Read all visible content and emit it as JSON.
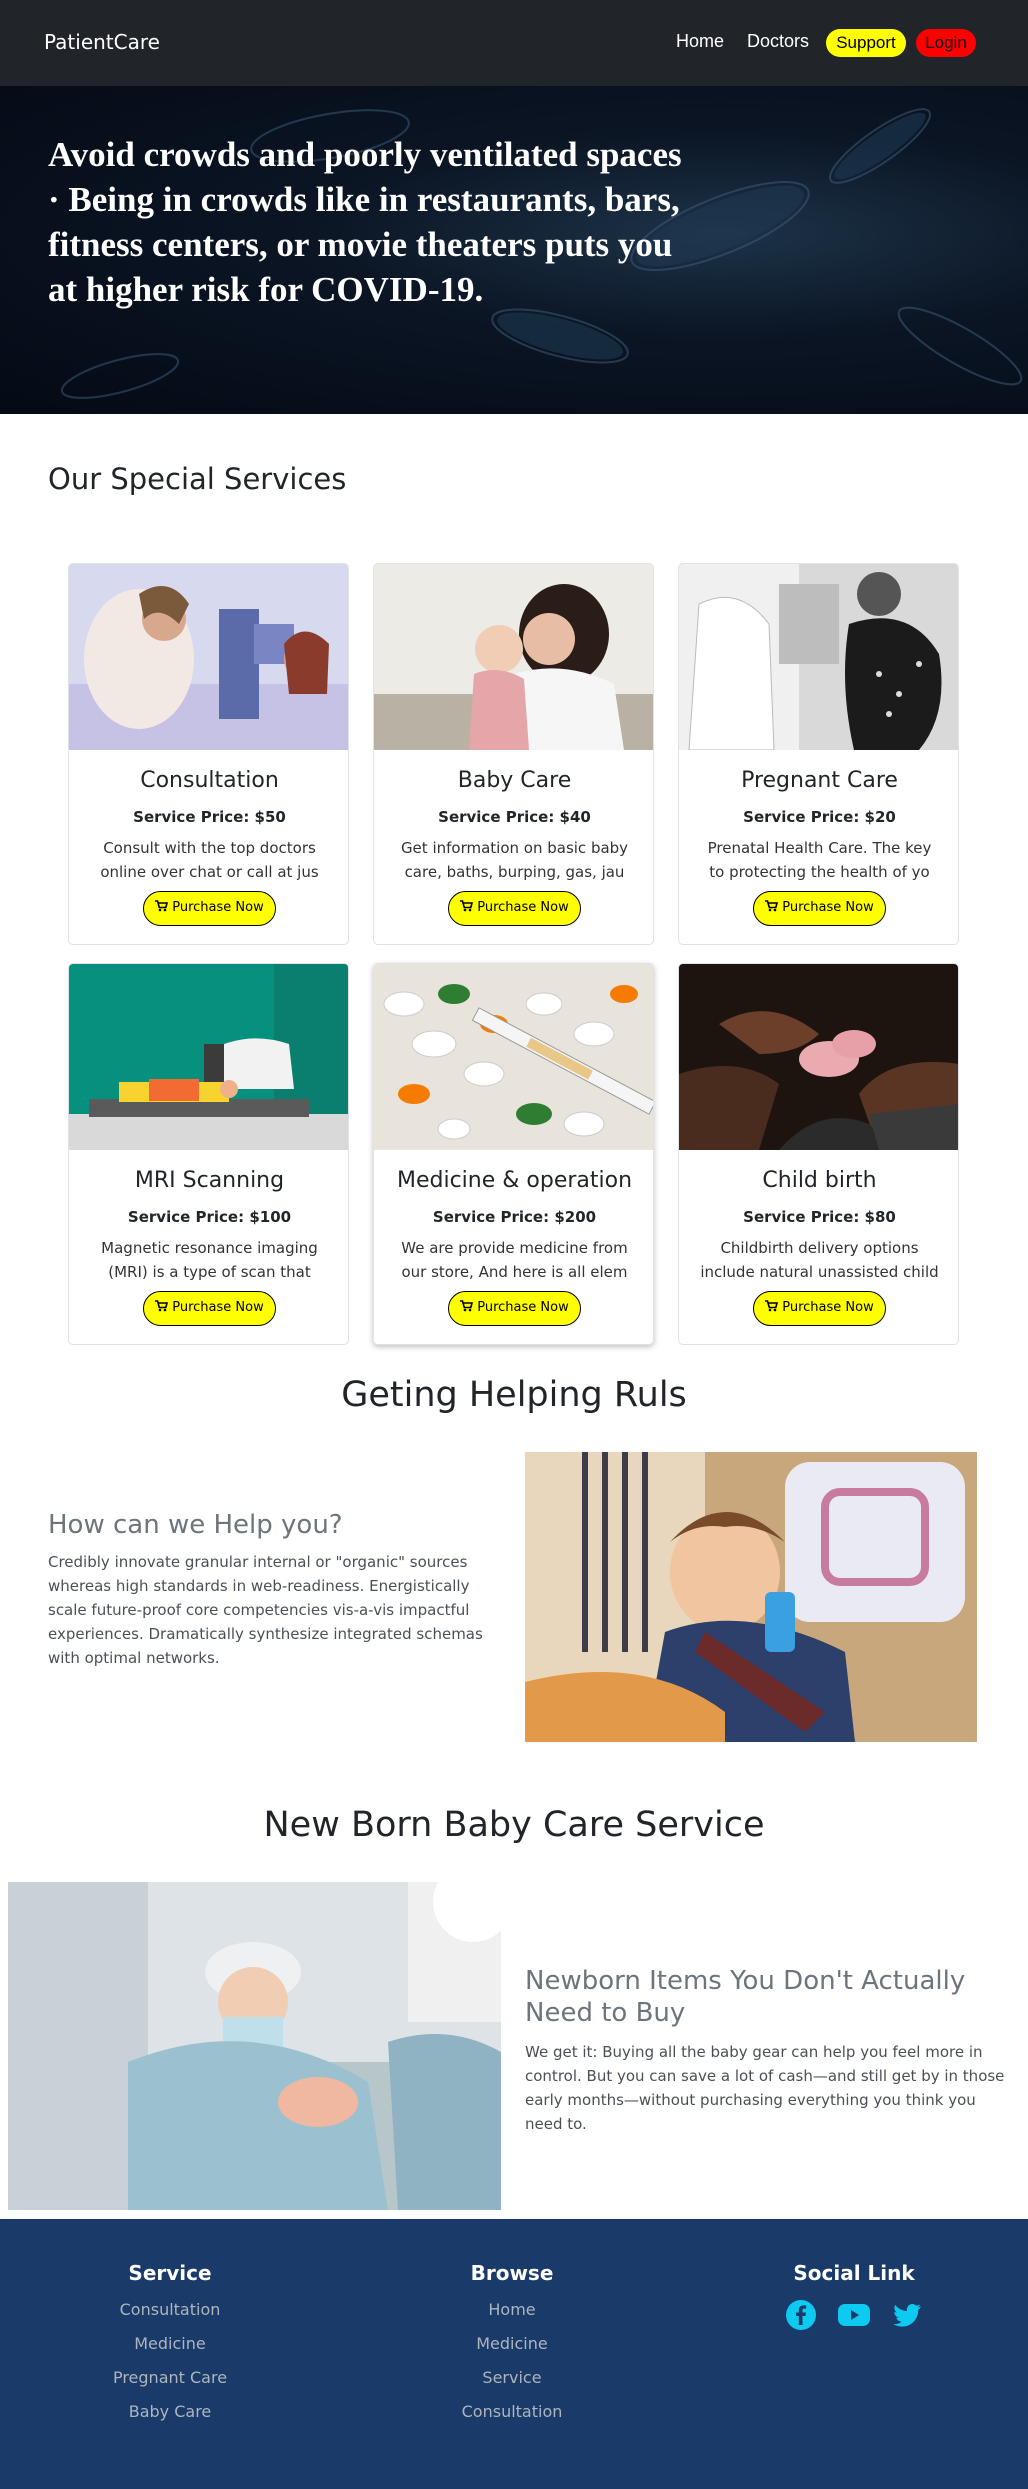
{
  "navbar": {
    "brand": "PatientCare",
    "home": "Home",
    "doctors": "Doctors",
    "support": "Support",
    "login": "Login"
  },
  "hero": {
    "text": "Avoid crowds and poorly ventilated spaces · Being in crowds like in restaurants, bars, fitness centers, or movie theaters puts you at higher risk for COVID-19."
  },
  "services": {
    "title": "Our Special Services",
    "button_label": "Purchase Now",
    "cards": [
      {
        "title": "Consultation",
        "price": "Service Price: $50",
        "desc": "Consult with the top doctors online over chat or call at jus"
      },
      {
        "title": "Baby Care",
        "price": "Service Price: $40",
        "desc": "Get information on basic baby care, baths, burping, gas, jau"
      },
      {
        "title": "Pregnant Care",
        "price": "Service Price: $20",
        "desc": "Prenatal Health Care. The key to protecting the health of yo"
      },
      {
        "title": "MRI Scanning",
        "price": "Service Price: $100",
        "desc": "Magnetic resonance imaging (MRI) is a type of scan that uses"
      },
      {
        "title": "Medicine & operation",
        "price": "Service Price: $200",
        "desc": "We are provide medicine from our store, And here is all elem"
      },
      {
        "title": "Child birth",
        "price": "Service Price: $80",
        "desc": "Childbirth delivery options include natural unassisted child"
      }
    ]
  },
  "help": {
    "title": "Geting Helping Ruls",
    "subtitle": "How can we Help you?",
    "body": "Credibly innovate granular internal or \"organic\" sources whereas high standards in web-readiness. Energistically scale future-proof core competencies vis-a-vis impactful experiences. Dramatically synthesize integrated schemas with optimal networks."
  },
  "newborn": {
    "title": "New Born Baby Care Service",
    "subtitle": "Newborn Items You Don't Actually Need to Buy",
    "body": "We get it: Buying all the baby gear can help you feel more in control. But you can save a lot of cash—and still get by in those early months—without purchasing everything you think you need to."
  },
  "footer": {
    "service": {
      "title": "Service",
      "links": [
        "Consultation",
        "Medicine",
        "Pregnant Care",
        "Baby Care"
      ]
    },
    "browse": {
      "title": "Browse",
      "links": [
        "Home",
        "Medicine",
        "Service",
        "Consultation"
      ]
    },
    "social": {
      "title": "Social Link",
      "icons": [
        "facebook-icon",
        "youtube-icon",
        "twitter-icon"
      ]
    }
  },
  "colors": {
    "navbar_bg": "#212529",
    "support_pill": "#ffff00",
    "login_pill": "#ff0000",
    "button_yellow": "#ffff00",
    "footer_bg": "#1a3a6a",
    "social_icon": "#0dcaf0"
  }
}
